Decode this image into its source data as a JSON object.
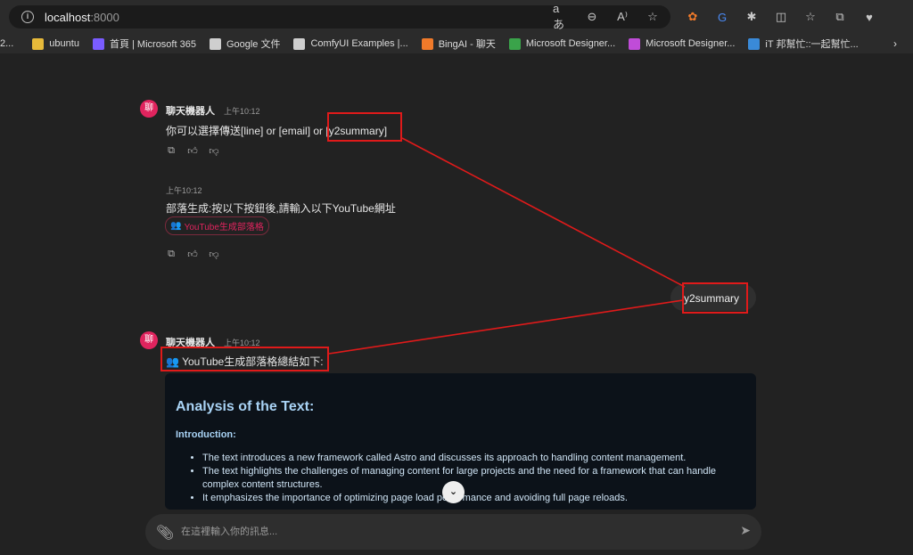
{
  "browser": {
    "url_host": "localhost",
    "url_port": ":8000",
    "bookmarks": [
      {
        "label": "2...",
        "color": "#dcdcdc"
      },
      {
        "label": "ubuntu",
        "color": "#e6b93a"
      },
      {
        "label": "首頁 | Microsoft 365",
        "color": "#7a5cff"
      },
      {
        "label": "Google 文件",
        "color": "#cfcfcf"
      },
      {
        "label": "ComfyUI Examples |...",
        "color": "#cfcfcf"
      },
      {
        "label": "BingAI - 聊天",
        "color": "#f07a2a"
      },
      {
        "label": "Microsoft Designer...",
        "color": "#3aa34a"
      },
      {
        "label": "Microsoft Designer...",
        "color": "#c04cd8"
      },
      {
        "label": "iT 邦幫忙::一起幫忙...",
        "color": "#3a8ad8"
      }
    ]
  },
  "chat": {
    "bot_name": "聊天機器人",
    "msg1": {
      "time": "上午10:12",
      "text": "你可以選擇傳送[line] or [email] or [y2summary]"
    },
    "msg2": {
      "time": "上午10:12",
      "text": "部落生成:按以下按鈕後,請輸入以下YouTube網址",
      "button": "YouTube生成部落格"
    },
    "user_msg": "y2summary",
    "msg3": {
      "time": "上午10:12",
      "text": "YouTube生成部落格總結如下:"
    },
    "card": {
      "title": "Analysis of the Text:",
      "subtitle": "Introduction:",
      "bullets": [
        "The text introduces a new framework called Astro and discusses its approach to handling content management.",
        "The text highlights the challenges of managing content for large projects and the need for a framework that can handle complex content structures.",
        "It emphasizes the importance of optimizing page load performance and avoiding full page reloads."
      ]
    },
    "input_placeholder": "在這裡輸入你的訊息...",
    "avatar_label": "聊",
    "accent_color": "#e0245e",
    "highlight_color": "#e01a1a"
  }
}
